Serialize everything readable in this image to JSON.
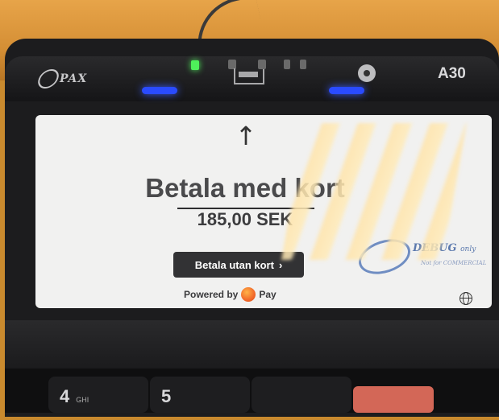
{
  "device": {
    "brand": "PAX",
    "model": "A30"
  },
  "screen": {
    "title": "Betala med kort",
    "amount": "185,00 SEK",
    "pay_without_card_label": "Betala utan kort",
    "pay_without_card_chevron": "›",
    "powered_by_label": "Powered by",
    "powered_by_brand": "Pay",
    "watermark_main": "DEBUG",
    "watermark_suffix": "only",
    "watermark_sub": "Not for COMMERCIAL",
    "arrow_glyph": "↑"
  },
  "keypad": {
    "key_4": "4",
    "key_4_sub": "GHI",
    "key_5": "5"
  },
  "colors": {
    "screen_bg": "#f1f1f0",
    "button_bg": "#323234",
    "led_green": "#4ef05a",
    "led_blue": "#2a4bff",
    "pay_logo": "#f2692a"
  },
  "icons": [
    "up-arrow-icon",
    "globe-icon",
    "pay-logo-icon",
    "camera-icon",
    "card-slot-icon"
  ]
}
